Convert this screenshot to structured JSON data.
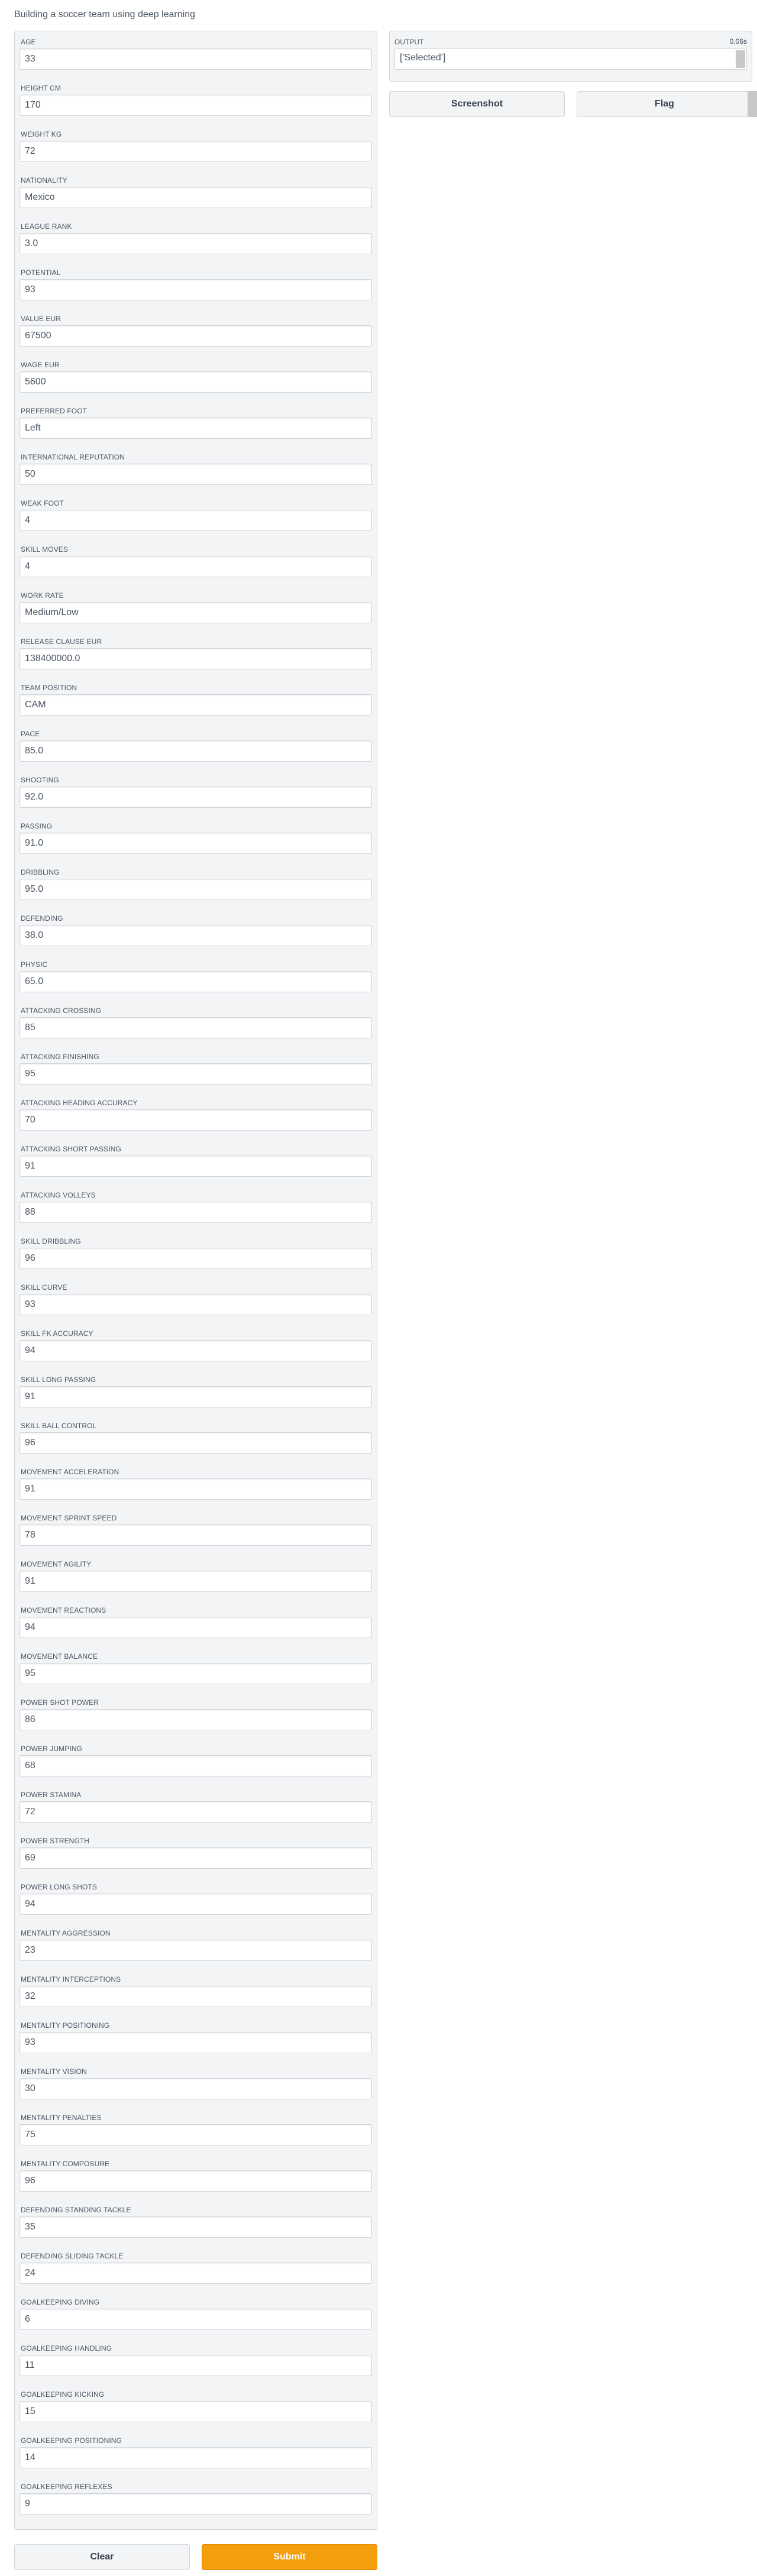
{
  "app": {
    "title": "Building a soccer team using deep learning"
  },
  "fields": [
    {
      "label": "AGE",
      "value": "33"
    },
    {
      "label": "HEIGHT CM",
      "value": "170"
    },
    {
      "label": "WEIGHT KG",
      "value": "72"
    },
    {
      "label": "NATIONALITY",
      "value": "Mexico"
    },
    {
      "label": "LEAGUE RANK",
      "value": "3.0"
    },
    {
      "label": "POTENTIAL",
      "value": "93"
    },
    {
      "label": "VALUE EUR",
      "value": "67500"
    },
    {
      "label": "WAGE EUR",
      "value": "5600"
    },
    {
      "label": "PREFERRED FOOT",
      "value": "Left"
    },
    {
      "label": "INTERNATIONAL REPUTATION",
      "value": "50"
    },
    {
      "label": "WEAK FOOT",
      "value": "4"
    },
    {
      "label": "SKILL MOVES",
      "value": "4"
    },
    {
      "label": "WORK RATE",
      "value": "Medium/Low"
    },
    {
      "label": "RELEASE CLAUSE EUR",
      "value": "138400000.0"
    },
    {
      "label": "TEAM POSITION",
      "value": "CAM"
    },
    {
      "label": "PACE",
      "value": "85.0"
    },
    {
      "label": "SHOOTING",
      "value": "92.0"
    },
    {
      "label": "PASSING",
      "value": "91.0"
    },
    {
      "label": "DRIBBLING",
      "value": "95.0"
    },
    {
      "label": "DEFENDING",
      "value": "38.0"
    },
    {
      "label": "PHYSIC",
      "value": "65.0"
    },
    {
      "label": "ATTACKING CROSSING",
      "value": "85"
    },
    {
      "label": "ATTACKING FINISHING",
      "value": "95"
    },
    {
      "label": "ATTACKING HEADING ACCURACY",
      "value": "70"
    },
    {
      "label": "ATTACKING SHORT PASSING",
      "value": "91"
    },
    {
      "label": "ATTACKING VOLLEYS",
      "value": "88"
    },
    {
      "label": "SKILL DRIBBLING",
      "value": "96"
    },
    {
      "label": "SKILL CURVE",
      "value": "93"
    },
    {
      "label": "SKILL FK ACCURACY",
      "value": "94"
    },
    {
      "label": "SKILL LONG PASSING",
      "value": "91"
    },
    {
      "label": "SKILL BALL CONTROL",
      "value": "96"
    },
    {
      "label": "MOVEMENT ACCELERATION",
      "value": "91"
    },
    {
      "label": "MOVEMENT SPRINT SPEED",
      "value": "78"
    },
    {
      "label": "MOVEMENT AGILITY",
      "value": "91"
    },
    {
      "label": "MOVEMENT REACTIONS",
      "value": "94"
    },
    {
      "label": "MOVEMENT BALANCE",
      "value": "95"
    },
    {
      "label": "POWER SHOT POWER",
      "value": "86"
    },
    {
      "label": "POWER JUMPING",
      "value": "68"
    },
    {
      "label": "POWER STAMINA",
      "value": "72"
    },
    {
      "label": "POWER STRENGTH",
      "value": "69"
    },
    {
      "label": "POWER LONG SHOTS",
      "value": "94"
    },
    {
      "label": "MENTALITY AGGRESSION",
      "value": "23"
    },
    {
      "label": "MENTALITY INTERCEPTIONS",
      "value": "32"
    },
    {
      "label": "MENTALITY POSITIONING",
      "value": "93"
    },
    {
      "label": "MENTALITY VISION",
      "value": "30"
    },
    {
      "label": "MENTALITY PENALTIES",
      "value": "75"
    },
    {
      "label": "MENTALITY COMPOSURE",
      "value": "96"
    },
    {
      "label": "DEFENDING STANDING TACKLE",
      "value": "35"
    },
    {
      "label": "DEFENDING SLIDING TACKLE",
      "value": "24"
    },
    {
      "label": "GOALKEEPING DIVING",
      "value": "6"
    },
    {
      "label": "GOALKEEPING HANDLING",
      "value": "11"
    },
    {
      "label": "GOALKEEPING KICKING",
      "value": "15"
    },
    {
      "label": "GOALKEEPING POSITIONING",
      "value": "14"
    },
    {
      "label": "GOALKEEPING REFLEXES",
      "value": "9"
    }
  ],
  "buttons": {
    "clear": "Clear",
    "submit": "Submit"
  },
  "output": {
    "label": "OUTPUT",
    "timer": "0.06s",
    "value": "['Selected']",
    "screenshot": "Screenshot",
    "flag": "Flag"
  },
  "colors": {
    "accent": "#f59e0b",
    "panel": "#f3f4f6",
    "border": "#d1d5db"
  }
}
